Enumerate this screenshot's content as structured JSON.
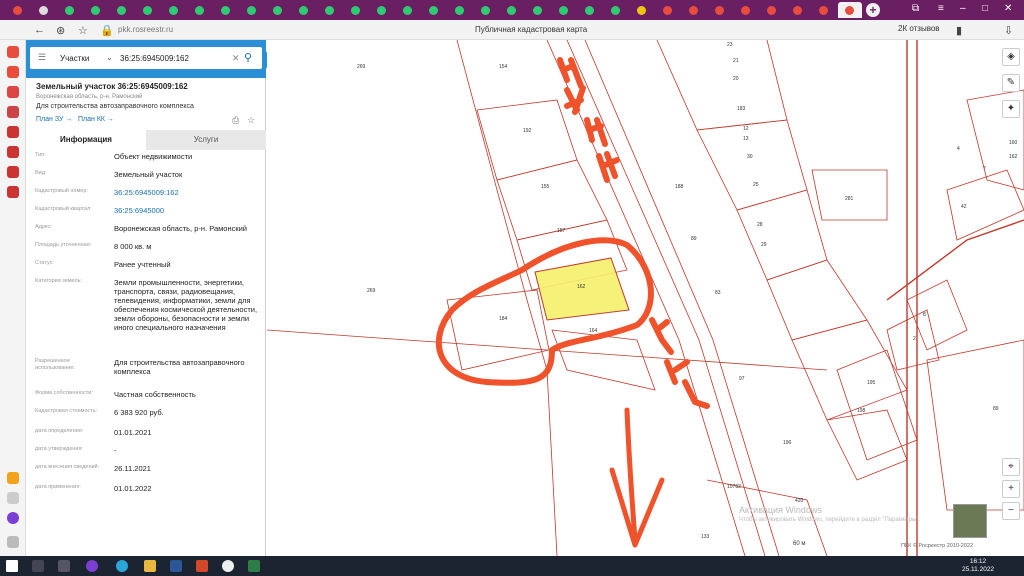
{
  "browser": {
    "url": "pkk.rosreestr.ru",
    "page_title": "Публичная кадастровая карта",
    "reviews": "2К отзывов"
  },
  "search": {
    "type": "Участки",
    "value": "36:25:6945009:162"
  },
  "object": {
    "title": "Земельный участок 36:25:6945009:162",
    "region": "Воронежская область, р-н. Рамонский",
    "use": "Для строительства автозаправочного комплекса",
    "plan_zu": "План ЗУ →",
    "plan_kk": "План КК →"
  },
  "tabs": {
    "info": "Информация",
    "services": "Услуги"
  },
  "fields": [
    {
      "label": "Тип:",
      "value": "Объект недвижимости",
      "link": false
    },
    {
      "label": "Вид:",
      "value": "Земельный участок",
      "link": false
    },
    {
      "label": "Кадастровый номер:",
      "value": "36:25:6945009:162",
      "link": true
    },
    {
      "label": "Кадастровый квартал:",
      "value": "36:25:6945000",
      "link": true
    },
    {
      "label": "Адрес:",
      "value": "Воронежская область, р-н. Рамонский",
      "link": false
    },
    {
      "label": "Площадь уточненная:",
      "value": "8 000 кв. м",
      "link": false
    },
    {
      "label": "Статус:",
      "value": "Ранее учтенный",
      "link": false
    },
    {
      "label": "Категория земель:",
      "value": "Земли промышленности, энергетики, транспорта, связи, радиовещания, телевидения, информатики, земли для обеспечения космической деятельности, земли обороны, безопасности и земли иного специального назначения",
      "link": false
    },
    {
      "label": "Разрешенное использование:",
      "value": "Для строительства автозаправочного комплекса",
      "link": false
    },
    {
      "label": "Форма собственности:",
      "value": "Частная собственность",
      "link": false
    },
    {
      "label": "Кадастровая стоимость:",
      "value": "6 383 920 руб.",
      "link": false
    },
    {
      "label": "дата определения:",
      "value": "01.01.2021",
      "link": false
    },
    {
      "label": "дата утверждения:",
      "value": "-",
      "link": false
    },
    {
      "label": "дата внесения сведений:",
      "value": "26.11.2021",
      "link": false
    },
    {
      "label": "дата применения:",
      "value": "01.01.2022",
      "link": false
    }
  ],
  "map": {
    "parcel_labels": [
      "269",
      "154",
      "192",
      "155",
      "187",
      "162",
      "164",
      "184",
      "269",
      "23",
      "21",
      "20",
      "183",
      "12",
      "13",
      "30",
      "188",
      "25",
      "28",
      "29",
      "89",
      "83",
      "97",
      "281",
      "162",
      "42",
      "7",
      "8",
      "2",
      "195",
      "198",
      "89",
      "196",
      "10782",
      "420",
      "133",
      "160",
      "4"
    ],
    "scale": "60 м",
    "watermark": "Активация Windows",
    "watermark_sub": "Чтобы активировать Windows, перейдите в раздел \"Параметры\".",
    "credits": "ПКК © Росреестр 2010-2022",
    "annotation_top": "474 км",
    "annotation_mid": "M-4"
  },
  "taskbar": {
    "time": "16:12",
    "date": "25.11.2022"
  },
  "colors": {
    "tabstrip": "#6b1f63",
    "search_bar": "#2a8fd4",
    "parcel_border": "#c0392b",
    "highlight": "#f5f06a",
    "annotation": "#f0532b"
  }
}
